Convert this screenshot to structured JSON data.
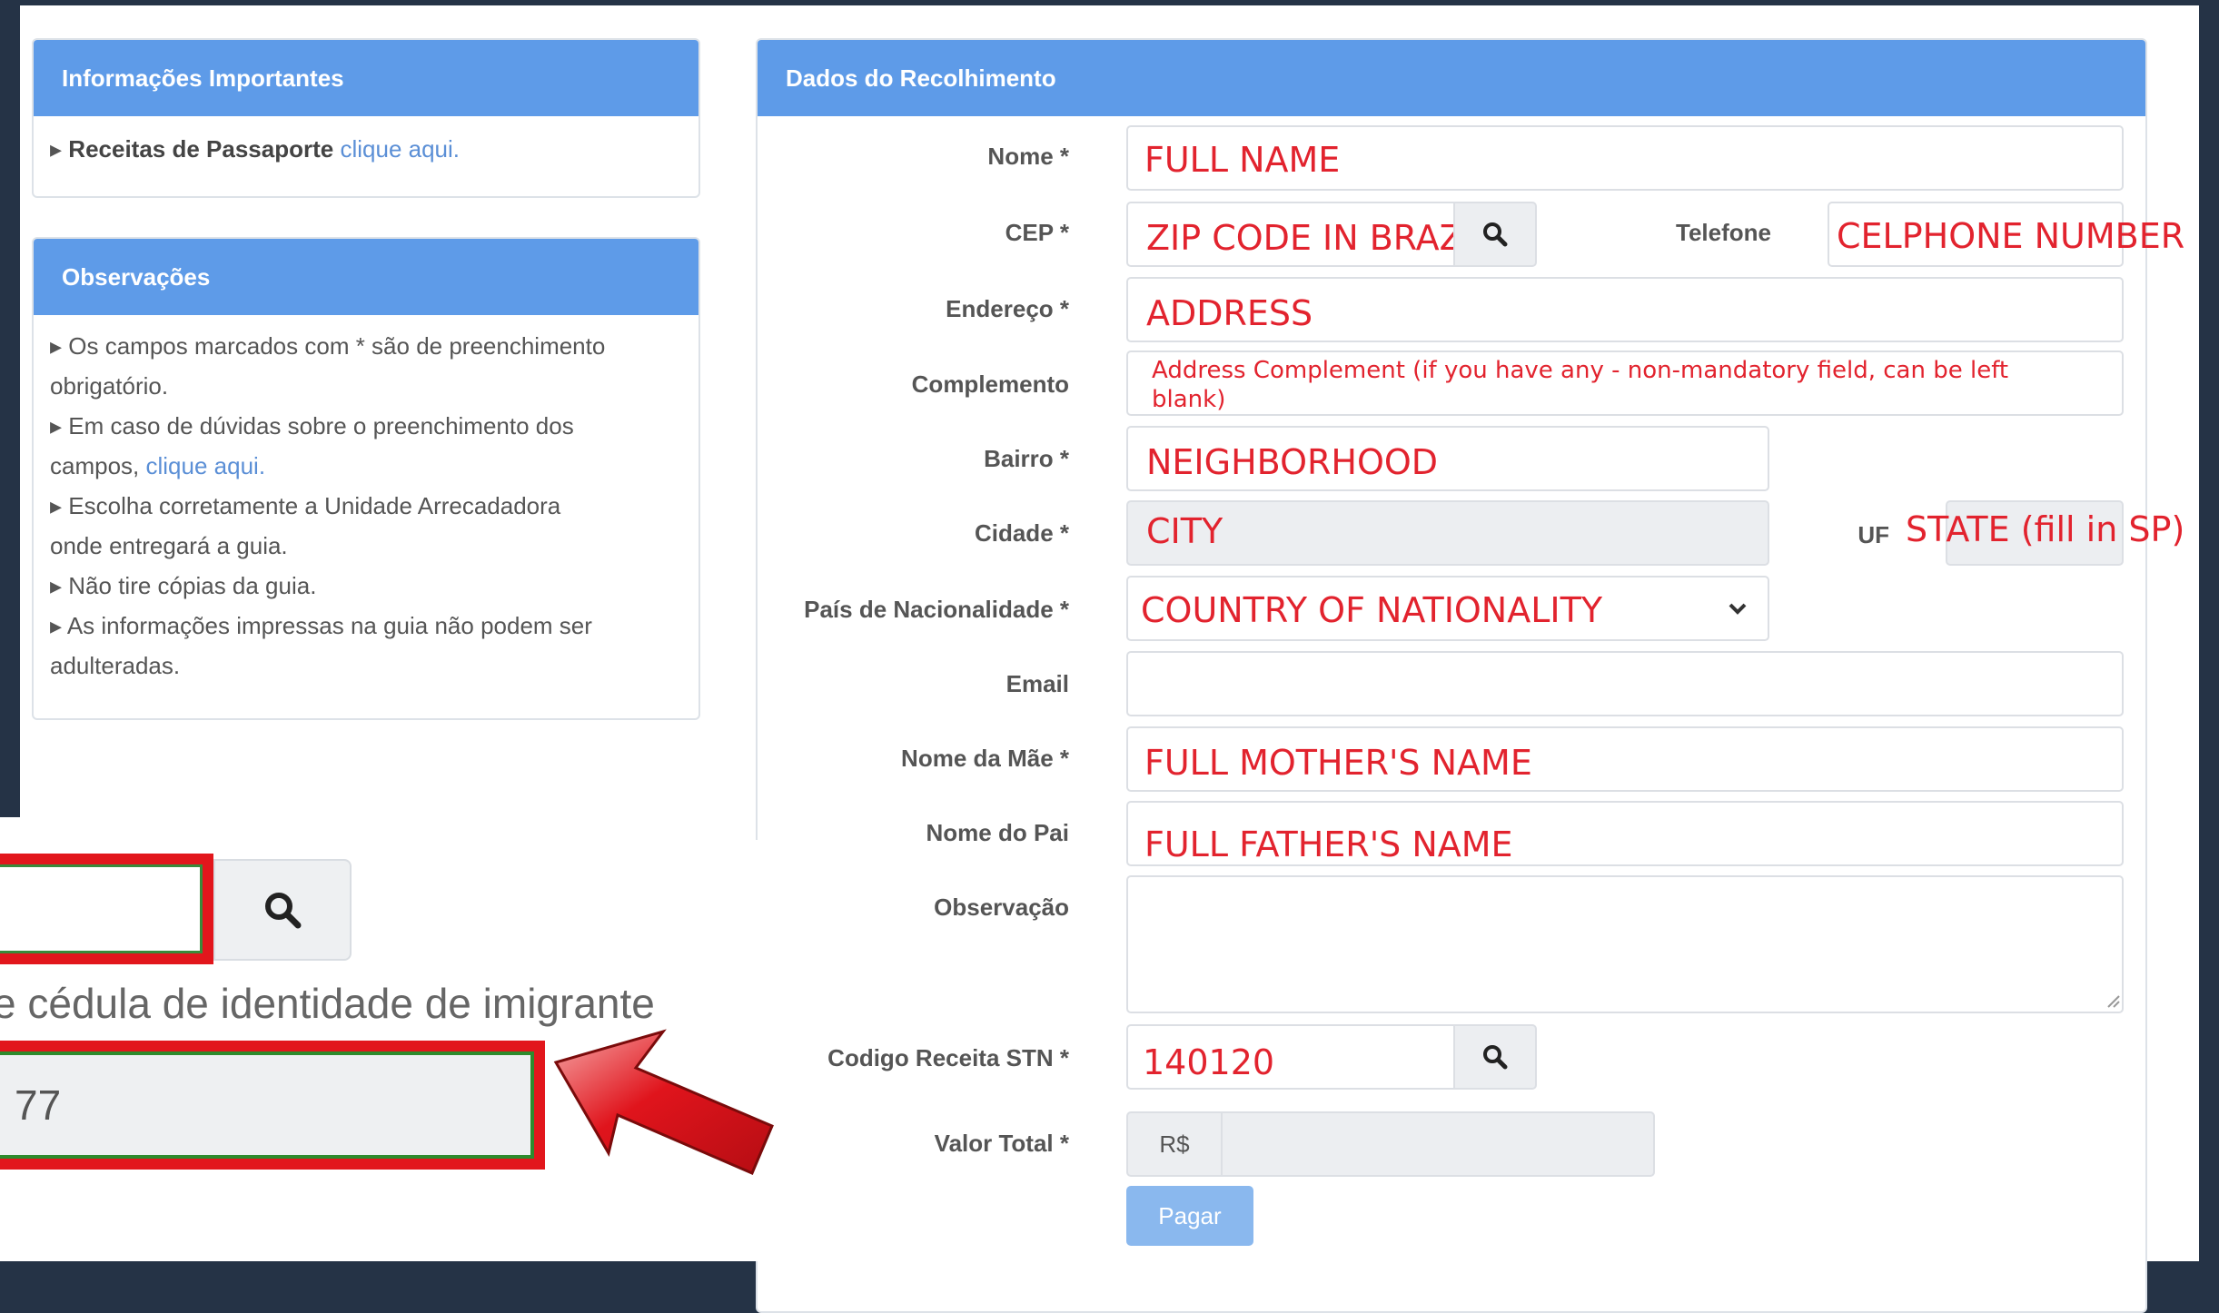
{
  "important": {
    "heading": "Informações Importantes",
    "bullet": "▸",
    "item_bold": "Receitas de Passaporte",
    "item_link": "clique aqui."
  },
  "observations": {
    "heading": "Observações",
    "lines": [
      "▸ Os campos marcados com * são de preenchimento",
      "obrigatório.",
      "▸ Em caso de dúvidas sobre o preenchimento dos",
      "campos,",
      "▸ Escolha corretamente a Unidade Arrecadadora",
      "onde entregará a guia.",
      "▸ Não tire cópias da guia.",
      "▸ As informações impressas na guia não podem ser",
      "adulteradas."
    ],
    "link": "clique aqui."
  },
  "form": {
    "heading": "Dados do Recolhimento",
    "labels": {
      "nome": "Nome *",
      "cep": "CEP *",
      "telefone": "Telefone",
      "endereco": "Endereço *",
      "complemento": "Complemento",
      "bairro": "Bairro *",
      "cidade": "Cidade *",
      "uf": "UF",
      "pais": "País de Nacionalidade *",
      "email": "Email",
      "mae": "Nome da Mãe *",
      "pai": "Nome do Pai",
      "observacao": "Observação",
      "codigo": "Codigo Receita STN *",
      "valor": "Valor Total *"
    },
    "values": {
      "nome": "FULL NAME",
      "cep": "ZIP CODE IN BRAZIL",
      "telefone": "CELPHONE NUMBER",
      "endereco": "ADDRESS",
      "complemento": "Address Complement (if you have any - non-mandatory field, can be left blank)",
      "bairro": "NEIGHBORHOOD",
      "cidade": "CITY",
      "uf": "STATE (fill in SP)",
      "pais": "COUNTRY OF NATIONALITY",
      "email": "",
      "mae": "FULL MOTHER'S NAME",
      "pai": "FULL FATHER'S NAME",
      "observacao": "",
      "codigo": "140120",
      "currency": "R$",
      "valor": ""
    },
    "pay_button": "Pagar"
  },
  "zoom": {
    "caption": "e cédula de identidade de imigrante",
    "value": "77"
  },
  "colors": {
    "header_blue": "#5e9be8",
    "annotation_red": "#e2232e",
    "frame_navy": "#253346"
  }
}
